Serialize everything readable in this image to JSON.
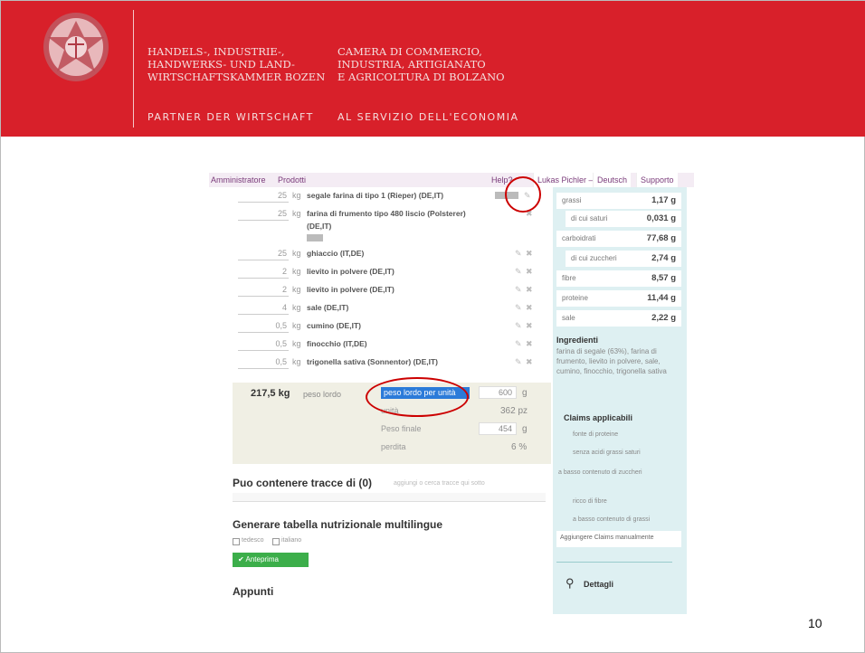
{
  "header": {
    "org_de": "HANDELS-, INDUSTRIE-,\nHANDWERKS- UND LAND-\nWIRTSCHAFTSKAMMER BOZEN",
    "org_it": "CAMERA DI COMMERCIO,\nINDUSTRIA, ARTIGIANATO\nE AGRICOLTURA DI BOLZANO",
    "motto_de": "PARTNER DER WIRTSCHAFT",
    "motto_it": "AL SERVIZIO DELL'ECONOMIA",
    "colors": {
      "band": "#d8202a"
    }
  },
  "app": {
    "nav": {
      "admin": "Amministratore",
      "products": "Prodotti",
      "help": "Help?",
      "user": "Lukas Pichler –",
      "lang": "Deutsch",
      "support": "Supporto"
    },
    "ingredients": [
      {
        "qty": "25",
        "unit": "kg",
        "name": "segale farina di tipo 1 (Rieper) (DE,IT)"
      },
      {
        "qty": "25",
        "unit": "kg",
        "name": "farina di frumento tipo 480 liscio (Polsterer)"
      },
      {
        "qty": "25",
        "unit": "kg",
        "name": "ghiaccio (IT,DE)"
      },
      {
        "qty": "2",
        "unit": "kg",
        "name": "lievito in polvere (DE,IT)"
      },
      {
        "qty": "2",
        "unit": "kg",
        "name": "lievito in polvere (DE,IT)"
      },
      {
        "qty": "4",
        "unit": "kg",
        "name": "sale (DE,IT)"
      },
      {
        "qty": "0,5",
        "unit": "kg",
        "name": "cumino (DE,IT)"
      },
      {
        "qty": "0,5",
        "unit": "kg",
        "name": "finocchio (IT,DE)"
      },
      {
        "qty": "0,5",
        "unit": "kg",
        "name": "trigonella sativa (Sonnentor) (DE,IT)"
      }
    ],
    "ingredient_2_extra": "(DE,IT)",
    "totals": {
      "total_weight": "217,5 kg",
      "gross_label": "peso lordo",
      "per_unit_label": "peso lordo per unità",
      "per_unit_value": "600",
      "per_unit_unit": "g",
      "units_label": "unità",
      "units_value": "362 pz",
      "final_weight_label": "Peso finale",
      "final_weight_value": "454",
      "final_weight_unit": "g",
      "loss_label": "perdita",
      "loss_value": "6 %"
    },
    "traces": {
      "title": "Puo contenere tracce di (0)",
      "hint": "aggiungi o cerca tracce qui sotto"
    },
    "nutrition": {
      "title": "Generare tabella nutrizionale multilingue",
      "lang1": "tedesco",
      "lang2": "italiano",
      "button": "✔ Anteprima"
    },
    "notes_title": "Appunti",
    "sidebar": {
      "nutrients": [
        {
          "k": "grassi",
          "v": "1,17 g"
        },
        {
          "k": "di cui saturi",
          "v": "0,031 g"
        },
        {
          "k": "carboidrati",
          "v": "77,68 g"
        },
        {
          "k": "di cui zuccheri",
          "v": "2,74 g"
        },
        {
          "k": "fibre",
          "v": "8,57 g"
        },
        {
          "k": "proteine",
          "v": "11,44 g"
        },
        {
          "k": "sale",
          "v": "2,22 g"
        }
      ],
      "ingredients_title": "Ingredienti",
      "ingredients_text": "farina di segale (63%), farina di frumento, lievito in polvere, sale, cumino, finocchio, trigonella sativa",
      "claims_title": "Claims applicabili",
      "claims": [
        "fonte di proteine",
        "senza acidi grassi saturi",
        "a basso contenuto di zuccheri",
        "ricco di fibre",
        "a basso contenuto di grassi"
      ],
      "claims_button": "Aggiungere Claims manualmente",
      "details": "Dettagli"
    }
  },
  "page_number": "10"
}
